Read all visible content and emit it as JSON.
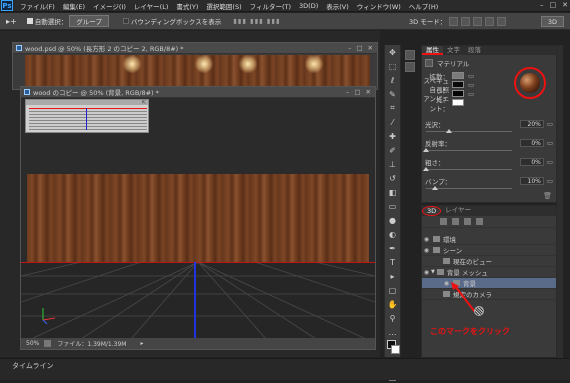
{
  "menubar": {
    "logo": "Ps",
    "items": [
      "ファイル(F)",
      "編集(E)",
      "イメージ(I)",
      "レイヤー(L)",
      "書式(Y)",
      "選択範囲(S)",
      "フィルター(T)",
      "3D(D)",
      "表示(V)",
      "ウィンドウ(W)",
      "ヘルプ(H)"
    ],
    "window_controls": [
      "–",
      "□",
      "✕"
    ]
  },
  "options": {
    "auto_select_label": "自動選択：",
    "auto_select_value": "グループ",
    "bounding_label": "バウンディングボックスを表示",
    "mode3d_label": "3D モード：",
    "workspace": "3D"
  },
  "doc1": {
    "title": "wood.psd @ 50% (長方形 2 のコピー 2, RGB/8#) *",
    "controls": [
      "–",
      "□",
      "✕"
    ]
  },
  "doc2": {
    "title": "wood のコピー @ 50% (背景, RGB/8#) *",
    "controls": [
      "–",
      "□",
      "✕"
    ],
    "zoom": "50%",
    "file_info": "ファイル：1.39M/1.39M",
    "arrow": "▸"
  },
  "properties": {
    "tabs": [
      "属性",
      "文字",
      "段落"
    ],
    "section": "マテリアル",
    "rows": [
      {
        "label": "拡散：",
        "color": "#7a7a7a"
      },
      {
        "label": "スペキュラ：",
        "color": "#0a0a0a"
      },
      {
        "label": "自己照光：",
        "color": "#050505"
      },
      {
        "label": "アンビエント：",
        "color": "#ffffff"
      }
    ],
    "sliders": [
      {
        "label": "光沢：",
        "value": "20%",
        "level": 0.2
      },
      {
        "label": "反射率：",
        "value": "0%",
        "level": 0
      },
      {
        "label": "粗さ：",
        "value": "0%",
        "level": 0
      },
      {
        "label": "バンプ：",
        "value": "10%",
        "level": 0.1
      }
    ]
  },
  "panel3d": {
    "tabs": [
      "3D",
      "レイヤー"
    ],
    "items": [
      {
        "label": "環境",
        "indent": 0,
        "eye": true
      },
      {
        "label": "シーン",
        "indent": 0,
        "eye": true
      },
      {
        "label": "現在のビュー",
        "indent": 1,
        "eye": false
      },
      {
        "label": "背景 メッシュ",
        "indent": 1,
        "eye": true
      },
      {
        "label": "背景",
        "indent": 2,
        "eye": true,
        "selected": true
      },
      {
        "label": "規定のカメラ",
        "indent": 1,
        "eye": false
      }
    ],
    "annotation": "このマークをクリック"
  },
  "statusbar": {
    "timeline": "タイムライン"
  },
  "colors": {
    "annotation_red": "#e11",
    "selection_blue": "#5a6b8a"
  }
}
